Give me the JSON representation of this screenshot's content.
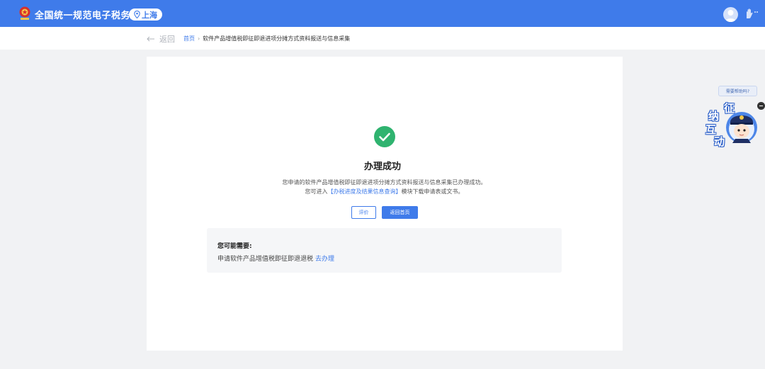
{
  "header": {
    "site_title": "全国统一规范电子税务局",
    "region": "上海",
    "icons": [
      "emblem-logo",
      "location-pin-icon",
      "user-avatar-icon",
      "hand-icon"
    ]
  },
  "nav": {
    "back_label": "返回",
    "breadcrumb_home": "首页",
    "breadcrumb_current": "软件产品增值税即征即退进项分摊方式资料报送与信息采集"
  },
  "result": {
    "title": "办理成功",
    "message_line1": "您申请的软件产品增值税即征即退进项分摊方式资料报送与信息采集已办理成功。",
    "message_line2_prefix": "您可进入",
    "message_line2_link": "【办税进度及结果信息查询】",
    "message_line2_suffix": "模块下载申请表或文书。",
    "evaluate_button": "评价",
    "home_button": "返回首页"
  },
  "suggestions": {
    "title": "您可能需要:",
    "items": [
      {
        "text": "申请软件产品增值税即征即退退税",
        "action": "去办理"
      }
    ]
  },
  "assistant": {
    "tip": "需要帮助吗?",
    "chars": [
      "征",
      "纳",
      "互",
      "动"
    ]
  },
  "colors": {
    "primary": "#3f7bea",
    "success": "#2fb36f",
    "page_bg": "#f1f2f4"
  }
}
